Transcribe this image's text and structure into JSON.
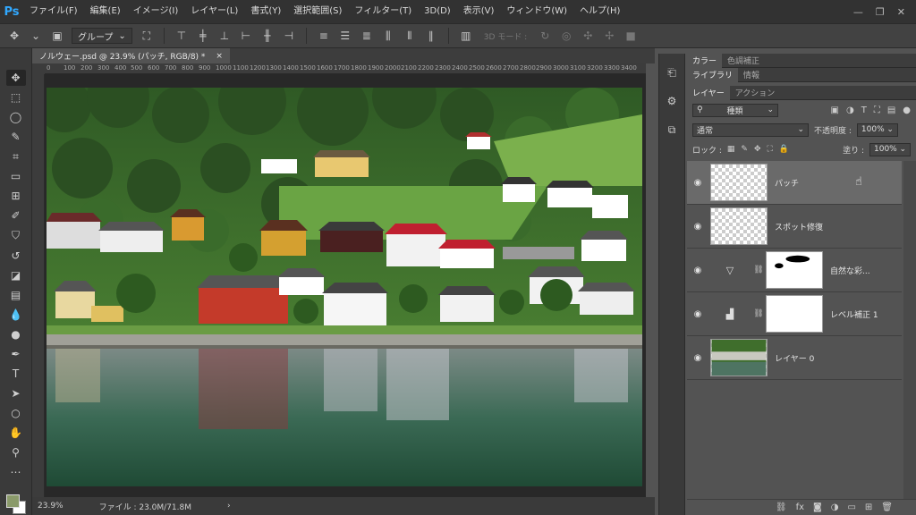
{
  "app": {
    "logo": "Ps"
  },
  "menu": [
    "ファイル(F)",
    "編集(E)",
    "イメージ(I)",
    "レイヤー(L)",
    "書式(Y)",
    "選択範囲(S)",
    "フィルター(T)",
    "3D(D)",
    "表示(V)",
    "ウィンドウ(W)",
    "ヘルプ(H)"
  ],
  "window_controls": {
    "minimize": "—",
    "restore": "❐",
    "close": "✕"
  },
  "options": {
    "auto_select": "グループ",
    "mode_3d": "3D モード :"
  },
  "document": {
    "tab_title": "ノルウェー.psd @ 23.9% (パッチ, RGB/8) *",
    "close": "×",
    "ruler_ticks": [
      "0",
      "100",
      "200",
      "300",
      "400",
      "500",
      "600",
      "700",
      "800",
      "900",
      "1000",
      "1100",
      "1200",
      "1300",
      "1400",
      "1500",
      "1600",
      "1700",
      "1800",
      "1900",
      "2000",
      "2100",
      "2200",
      "2300",
      "2400",
      "2500",
      "2600",
      "2700",
      "2800",
      "2900",
      "3000",
      "3100",
      "3200",
      "3300",
      "3400"
    ]
  },
  "status": {
    "zoom": "23.9%",
    "file_info": "ファイル : 23.0M/71.8M",
    "arrow": "›"
  },
  "panels": {
    "top_tabs": [
      "カラー",
      "色調補正"
    ],
    "mid_tabs": [
      "ライブラリ",
      "情報"
    ],
    "layer_tabs": [
      "レイヤー",
      "アクション"
    ],
    "filter_kind": "種類",
    "blend_mode": "通常",
    "opacity_label": "不透明度 :",
    "opacity_value": "100%",
    "lock_label": "ロック :",
    "fill_label": "塗り :",
    "fill_value": "100%"
  },
  "layers": [
    {
      "name": "パッチ",
      "kind": "transparent",
      "selected": true
    },
    {
      "name": "スポット修復",
      "kind": "transparent",
      "selected": false
    },
    {
      "name": "自然な彩...",
      "kind": "adjustment-vibrance",
      "selected": false
    },
    {
      "name": "レベル補正 1",
      "kind": "adjustment-levels",
      "selected": false
    },
    {
      "name": "レイヤー 0",
      "kind": "photo",
      "selected": false
    }
  ],
  "colors": {
    "accent": "#31a8ff",
    "fg_swatch": "#8a9a6a",
    "bg_swatch": "#ffffff"
  }
}
